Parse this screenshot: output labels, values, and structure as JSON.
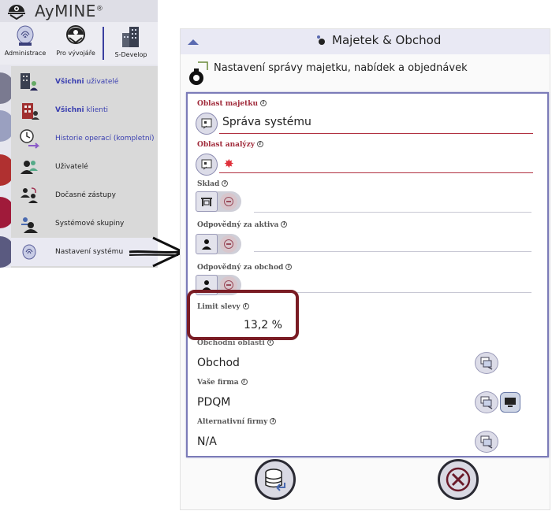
{
  "app": {
    "title": "AyMINE",
    "title_mark": "®",
    "toolbar": [
      {
        "label": "Administrace",
        "icon": "fingerprint-icon"
      },
      {
        "label": "Pro vývojáře",
        "icon": "gear-helmet-icon"
      },
      {
        "label": "S-Develop",
        "icon": "building-icon"
      }
    ]
  },
  "menu": {
    "items": [
      {
        "label_bold": "Všichni",
        "label_rest": " uživatelé",
        "icon": "building-users-icon",
        "style": "blue"
      },
      {
        "label_bold": "Všichni",
        "label_rest": " klienti",
        "icon": "red-building-icon",
        "style": "blue"
      },
      {
        "label_bold": "",
        "label_rest": "Historie operací (kompletní)",
        "icon": "history-clock-icon",
        "style": "blue"
      },
      {
        "label_bold": "",
        "label_rest": "Uživatelé",
        "icon": "users-icon",
        "style": "plain"
      },
      {
        "label_bold": "",
        "label_rest": "Dočasné zástupy",
        "icon": "substitute-users-icon",
        "style": "plain"
      },
      {
        "label_bold": "",
        "label_rest": "Systémové skupiny",
        "icon": "system-group-icon",
        "style": "plain"
      },
      {
        "label_bold": "",
        "label_rest": "Nastavení systému",
        "icon": "settings-fingerprint-icon",
        "style": "plain"
      }
    ]
  },
  "panel": {
    "title": "Majetek & Obchod",
    "subtitle": "Nastavení správy majetku, nabídek a objednávek"
  },
  "form": {
    "oblast_majetku": {
      "label": "Oblast majetku",
      "value": "Správa systému"
    },
    "oblast_analyzy": {
      "label": "Oblast analýzy",
      "value": "✸"
    },
    "sklad": {
      "label": "Sklad"
    },
    "odpovedny_aktiva": {
      "label": "Odpovědný za aktiva"
    },
    "odpovedny_obchod": {
      "label": "Odpovědný za obchod"
    },
    "limit_slevy": {
      "label": "Limit slevy",
      "value": "13,2 %"
    },
    "obchodni_oblasti": {
      "label": "Obchodní oblasti",
      "value": "Obchod"
    },
    "vase_firma": {
      "label": "Vaše firma",
      "value": "PDQM"
    },
    "alternativni_firmy": {
      "label": "Alternativní firmy",
      "value": "N/A"
    }
  },
  "info_glyph": "i",
  "colors": {
    "required_label": "#a02a3a",
    "form_border": "#7b7bb8",
    "highlight": "#7a1c24"
  }
}
